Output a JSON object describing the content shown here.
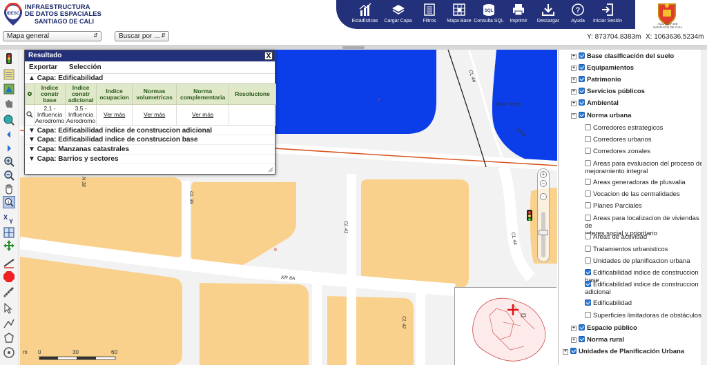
{
  "header": {
    "logo_badge": "IDESC",
    "logo_line1": "INFRAESTRUCTURA",
    "logo_line2": "DE DATOS ESPACIALES",
    "logo_line3": "SANTIAGO DE CALI",
    "tools": [
      {
        "label": "Estadísticas",
        "icon": "bar-chart-icon"
      },
      {
        "label": "Cargar Capa",
        "icon": "layers-icon"
      },
      {
        "label": "Filtros",
        "icon": "filter-list-icon"
      },
      {
        "label": "Mapa Base",
        "icon": "map-grid-icon"
      },
      {
        "label": "Consulta SQL",
        "icon": "sql-icon"
      },
      {
        "label": "Imprimir",
        "icon": "printer-icon"
      },
      {
        "label": "Descargar",
        "icon": "download-icon"
      },
      {
        "label": "Ayuda",
        "icon": "help-icon"
      },
      {
        "label": "Iniciar Sesión",
        "icon": "login-icon"
      }
    ],
    "crest_label_1": "ALCALDÍA DE",
    "crest_label_2": "SANTIAGO DE CALI",
    "accent_color": "#23307a"
  },
  "subbar": {
    "map_select": "Mapa general",
    "search_select": "Buscar por ...",
    "coord_y": "Y: 873704.8383m",
    "coord_x": "X: 1063636.5234m"
  },
  "left_tools": [
    "traffic-light-icon",
    "layers-panel-icon",
    "legend-icon",
    "pan-hand-icon",
    "globe-zoom-icon",
    "prev-arrow-icon",
    "next-arrow-icon",
    "zoom-in-icon",
    "zoom-out-icon",
    "hand-icon",
    "info-query-icon",
    "measure-xy-icon",
    "select-box-icon",
    "move-icon",
    "edit-line-icon",
    "stop-icon",
    "ruler-icon",
    "pointer-select-icon",
    "draw-line-icon",
    "draw-polygon-icon",
    "buffer-icon",
    "circle-icon"
  ],
  "result": {
    "title": "Resultado",
    "menu_export": "Exportar",
    "menu_select": "Selección",
    "close": "X",
    "layer_open": "Capa: Edificabilidad",
    "columns": [
      "Indice constr base",
      "Indice constr adicional",
      "Indice ocupacion",
      "Normas volumetricas",
      "Norma complementaria",
      "Resolucione"
    ],
    "row": [
      "2,1 - Influencia Aerodromo",
      "3,5 - Influencia Aerodromo",
      "Ver más",
      "Ver más",
      "Ver más",
      ""
    ],
    "layers_closed": [
      "Capa: Edificabilidad indice de construccion adicional",
      "Capa: Edificabilidad indice de construccion base",
      "Capa: Manzanas catastrales",
      "Capa: Barrios y sectores"
    ]
  },
  "map": {
    "labels": {
      "cl44_top": "CL 44",
      "cl44_mid": "CL 44",
      "kr6": "KR 6",
      "base_aerea": "Base Aérea",
      "kr8a": "KR 8A",
      "cl39": "CL 39",
      "cl41": "CL 41",
      "cl42": "CL 42",
      "n38": "N 38",
      "num7": "7",
      "num8": "8"
    },
    "colors": {
      "blue": "#0b3ee8",
      "block": "#f9d18c",
      "road_red": "#d9541f"
    },
    "scale_0": "0",
    "scale_30": "30",
    "scale_60": "60",
    "scale_unit": "m"
  },
  "tree": {
    "items": [
      {
        "label": "Base clasificación del suelo",
        "bold": true,
        "plus": true,
        "checked": true
      },
      {
        "label": "Equipamientos",
        "bold": true,
        "plus": true,
        "checked": true
      },
      {
        "label": "Patrimonio",
        "bold": true,
        "plus": true,
        "checked": true
      },
      {
        "label": "Servicios públicos",
        "bold": true,
        "plus": true,
        "checked": true
      },
      {
        "label": "Ambiental",
        "bold": true,
        "plus": true,
        "checked": true
      },
      {
        "label": "Norma urbana",
        "bold": true,
        "plus": true,
        "checked": true
      },
      {
        "label": "Corredores estrategicos",
        "checked": false
      },
      {
        "label": "Corredores urbanos",
        "checked": false
      },
      {
        "label": "Corredores zonales",
        "checked": false
      },
      {
        "label": "Areas para evaluacion del proceso de",
        "label2": "mejoramiento integral",
        "checked": false
      },
      {
        "label": "Areas generadoras de plusvalia",
        "checked": false
      },
      {
        "label": "Vocacion de las centralidades",
        "checked": false
      },
      {
        "label": "Planes Parciales",
        "checked": false
      },
      {
        "label": "Areas para localizacion de viviendas de",
        "label2": "interes social y prioritario",
        "checked": false
      },
      {
        "label": "Areas de actividad",
        "checked": false
      },
      {
        "label": "Tratamientos urbanisticos",
        "checked": false
      },
      {
        "label": "Unidades de planificacion urbana",
        "checked": false
      },
      {
        "label": "Edificabilidad indice de construccion base",
        "checked": true
      },
      {
        "label": "Edificabilidad indice de construccion",
        "label2": "adicional",
        "checked": true
      },
      {
        "label": "Edificabilidad",
        "checked": true
      },
      {
        "label": "Superficies limitadoras de obstáculos",
        "checked": false
      },
      {
        "label": "Espacio público",
        "bold": true,
        "plus": true,
        "checked": true
      },
      {
        "label": "Norma rural",
        "bold": true,
        "plus": true,
        "checked": true
      },
      {
        "label": "Unidades de Planificación Urbana",
        "bold": true,
        "plus": true,
        "checked": true
      }
    ]
  }
}
